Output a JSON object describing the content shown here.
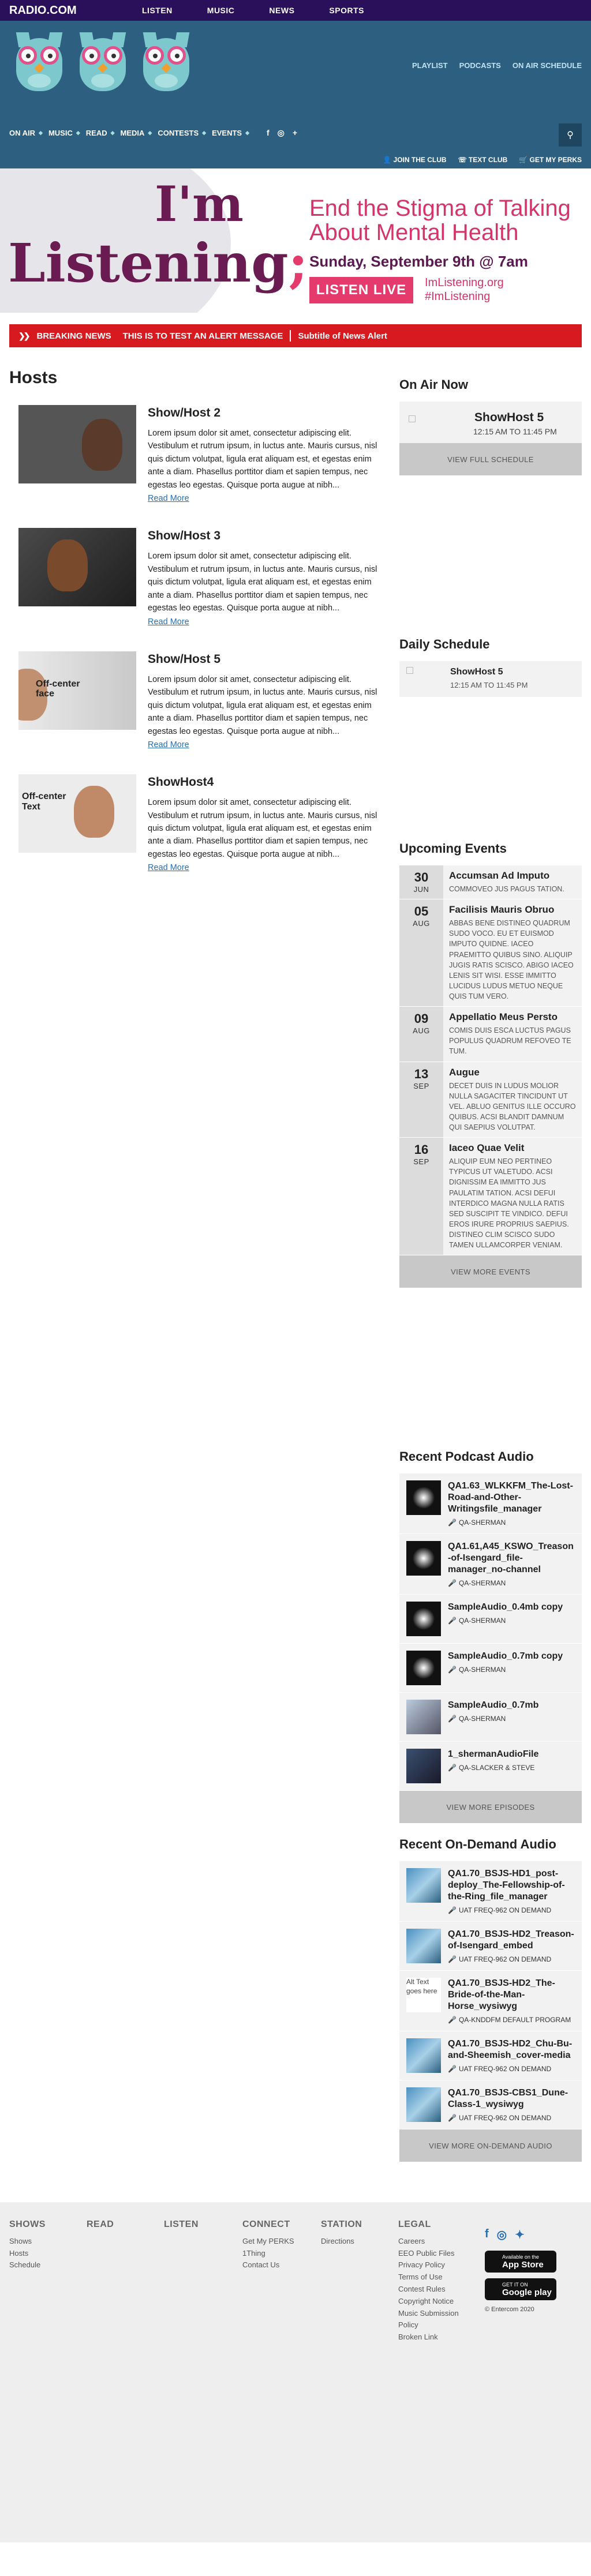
{
  "topbar": {
    "brand": "RADIO.COM",
    "nav": [
      "LISTEN",
      "MUSIC",
      "NEWS",
      "SPORTS"
    ]
  },
  "header": {
    "util_links": [
      "PLAYLIST",
      "PODCASTS",
      "ON AIR SCHEDULE"
    ],
    "nav": [
      "ON AIR",
      "MUSIC",
      "READ",
      "MEDIA",
      "CONTESTS",
      "EVENTS"
    ],
    "social": [
      "f",
      "◎",
      "+"
    ],
    "clubs": [
      "JOIN THE CLUB",
      "TEXT CLUB",
      "GET MY PERKS"
    ]
  },
  "banner": {
    "im": "I'm",
    "listening": "Listening",
    "semicolon": ";",
    "headline": "End the Stigma of Talking About Mental Health",
    "when": "Sunday, September 9th @ 7am",
    "cta": "LISTEN LIVE",
    "site1": "ImListening.org",
    "site2": "#ImListening"
  },
  "breaking": {
    "label": "BREAKING NEWS",
    "message": "THIS IS TO TEST AN ALERT MESSAGE",
    "subtitle": "Subtitle of News Alert"
  },
  "hosts": {
    "title": "Hosts",
    "read_more": "Read More",
    "lorem": "Lorem ipsum dolor sit amet, consectetur adipiscing elit. Vestibulum et rutrum ipsum, in luctus ante. Mauris cursus, nisl quis dictum volutpat, ligula erat aliquam est, et egestas enim ante a diam. Phasellus porttitor diam et sapien tempus, nec egestas leo egestas. Quisque porta augue at nibh...",
    "items": [
      {
        "name": "Show/Host 2",
        "overlay": ""
      },
      {
        "name": "Show/Host 3",
        "overlay": ""
      },
      {
        "name": "Show/Host 5",
        "overlay": "Off-center face"
      },
      {
        "name": "ShowHost4",
        "overlay": "Off-center Text"
      }
    ]
  },
  "onair": {
    "title": "On Air Now",
    "name": "ShowHost 5",
    "time": "12:15 AM TO 11:45 PM",
    "button": "VIEW FULL SCHEDULE"
  },
  "daily": {
    "title": "Daily Schedule",
    "name": "ShowHost 5",
    "time": "12:15 AM TO 11:45 PM"
  },
  "events": {
    "title": "Upcoming Events",
    "button": "VIEW MORE EVENTS",
    "items": [
      {
        "day": "30",
        "month": "JUN",
        "title": "Accumsan Ad Imputo",
        "text": "COMMOVEO JUS PAGUS TATION."
      },
      {
        "day": "05",
        "month": "AUG",
        "title": "Facilisis Mauris Obruo",
        "text": "ABBAS BENE DISTINEO QUADRUM SUDO VOCO. EU ET EUISMOD IMPUTO QUIDNE. IACEO PRAEMITTO QUIBUS SINO. ALIQUIP JUGIS RATIS SCISCO. ABIGO IACEO LENIS SIT WISI. ESSE IMMITTO LUCIDUS LUDUS METUO NEQUE QUIS TUM VERO."
      },
      {
        "day": "09",
        "month": "AUG",
        "title": "Appellatio Meus Persto",
        "text": "COMIS DUIS ESCA LUCTUS PAGUS POPULUS QUADRUM REFOVEO TE TUM."
      },
      {
        "day": "13",
        "month": "SEP",
        "title": "Augue",
        "text": "DECET DUIS IN LUDUS MOLIOR NULLA SAGACITER TINCIDUNT UT VEL. ABLUO GENITUS ILLE OCCURO QUIBUS. ACSI BLANDIT DAMNUM QUI SAEPIUS VOLUTPAT."
      },
      {
        "day": "16",
        "month": "SEP",
        "title": "Iaceo Quae Velit",
        "text": "ALIQUIP EUM NEO PERTINEO TYPICUS UT VALETUDO. ACSI DIGNISSIM EA IMMITTO JUS PAULATIM TATION. ACSI DEFUI INTERDICO MAGNA NULLA RATIS SED SUSCIPIT TE VINDICO. DEFUI EROS IRURE PROPRIUS SAEPIUS. DISTINEO CLIM SCISCO SUDO TAMEN ULLAMCORPER VENIAM."
      }
    ]
  },
  "podcasts": {
    "title": "Recent Podcast Audio",
    "button": "VIEW MORE EPISODES",
    "items": [
      {
        "title": "QA1.63_WLKKFM_The-Lost-Road-and-Other-Writingsfile_manager",
        "author": "QA-SHERMAN"
      },
      {
        "title": "QA1.61,A45_KSWO_Treason-of-Isengard_file-manager_no-channel",
        "author": "QA-SHERMAN"
      },
      {
        "title": "SampleAudio_0.4mb copy",
        "author": "QA-SHERMAN"
      },
      {
        "title": "SampleAudio_0.7mb copy",
        "author": "QA-SHERMAN"
      },
      {
        "title": "SampleAudio_0.7mb",
        "author": "QA-SHERMAN"
      },
      {
        "title": "1_shermanAudioFile",
        "author": "QA-SLACKER & STEVE"
      }
    ]
  },
  "ondemand": {
    "title": "Recent On-Demand Audio",
    "button": "VIEW MORE ON-DEMAND AUDIO",
    "noimg": "Alt Text goes here",
    "items": [
      {
        "title": "QA1.70_BSJS-HD1_post-deploy_The-Fellowship-of-the-Ring_file_manager",
        "author": "UAT FREQ-962 ON DEMAND"
      },
      {
        "title": "QA1.70_BSJS-HD2_Treason-of-Isengard_embed",
        "author": "UAT FREQ-962 ON DEMAND"
      },
      {
        "title": "QA1.70_BSJS-HD2_The-Bride-of-the-Man-Horse_wysiwyg",
        "author": "QA-KNDDFM DEFAULT PROGRAM"
      },
      {
        "title": "QA1.70_BSJS-HD2_Chu-Bu-and-Sheemish_cover-media",
        "author": "UAT FREQ-962 ON DEMAND"
      },
      {
        "title": "QA1.70_BSJS-CBS1_Dune-Class-1_wysiwyg",
        "author": "UAT FREQ-962 ON DEMAND"
      }
    ]
  },
  "footer": {
    "cols": [
      {
        "h": "SHOWS",
        "items": [
          "Shows",
          "Hosts",
          "Schedule"
        ]
      },
      {
        "h": "READ",
        "items": []
      },
      {
        "h": "LISTEN",
        "items": []
      },
      {
        "h": "CONNECT",
        "items": [
          "Get My PERKS",
          "1Thing",
          "Contact Us"
        ]
      },
      {
        "h": "STATION",
        "items": [
          "Directions"
        ]
      },
      {
        "h": "LEGAL",
        "items": [
          "Careers",
          "EEO Public Files",
          "Privacy Policy",
          "Terms of Use",
          "Contest Rules",
          "Copyright Notice",
          "Music Submission Policy",
          "Broken Link"
        ]
      }
    ],
    "appstore_small": "Available on the",
    "appstore": "App Store",
    "gplay_small": "GET IT ON",
    "gplay": "Google play",
    "copyright": "© Entercom 2020"
  }
}
